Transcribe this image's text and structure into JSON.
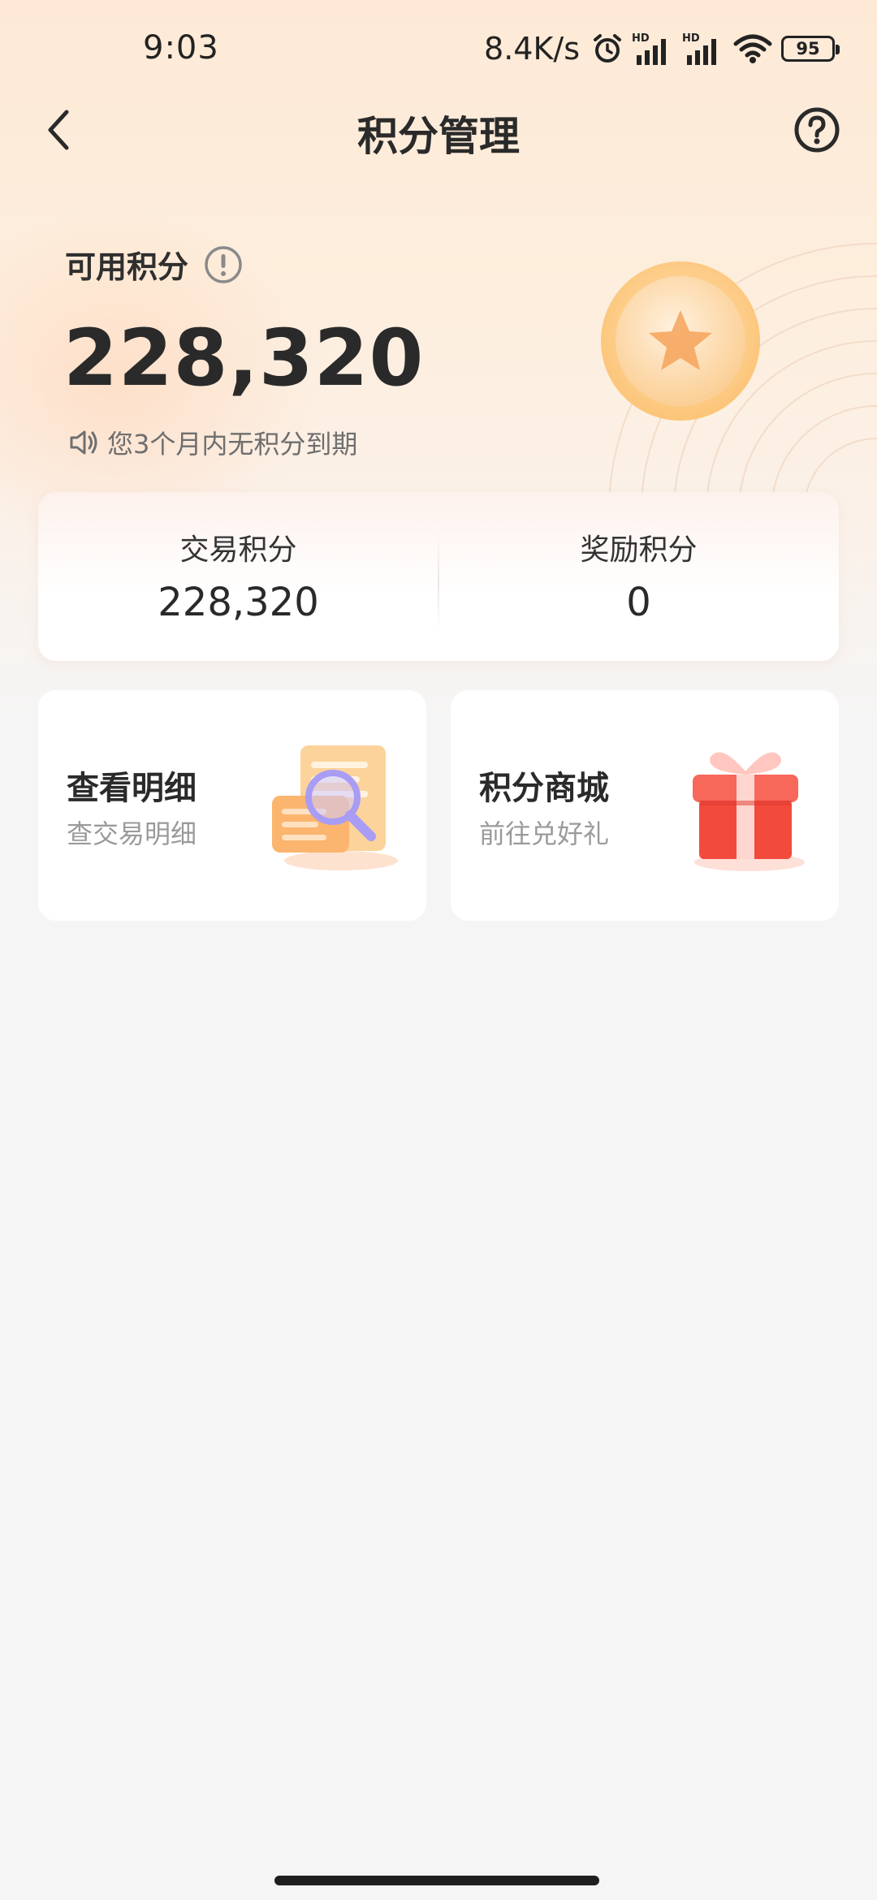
{
  "status_bar": {
    "time": "9:03",
    "net_speed": "8.4K/s",
    "battery": "95",
    "icons": [
      "alarm-icon",
      "hd-signal-icon",
      "hd-signal-icon",
      "wifi-icon",
      "battery-icon"
    ]
  },
  "header": {
    "title": "积分管理",
    "back_icon": "chevron-left-icon",
    "help_icon": "question-circle-icon"
  },
  "points": {
    "label": "可用积分",
    "value": "228,320",
    "expire_note": "您3个月内无积分到期",
    "info_icon": "info-circle-icon",
    "speaker_icon": "speaker-icon"
  },
  "summary": {
    "trade": {
      "label": "交易积分",
      "value": "228,320"
    },
    "reward": {
      "label": "奖励积分",
      "value": "0"
    }
  },
  "actions": {
    "detail": {
      "title": "查看明细",
      "subtitle": "查交易明细",
      "icon": "document-search-icon"
    },
    "mall": {
      "title": "积分商城",
      "subtitle": "前往兑好礼",
      "icon": "gift-icon"
    }
  },
  "colors": {
    "accent": "#f6a35a",
    "hero_bg": "#fde9d6",
    "page_bg": "#f5f5f5",
    "gift_red": "#f24a3c"
  }
}
